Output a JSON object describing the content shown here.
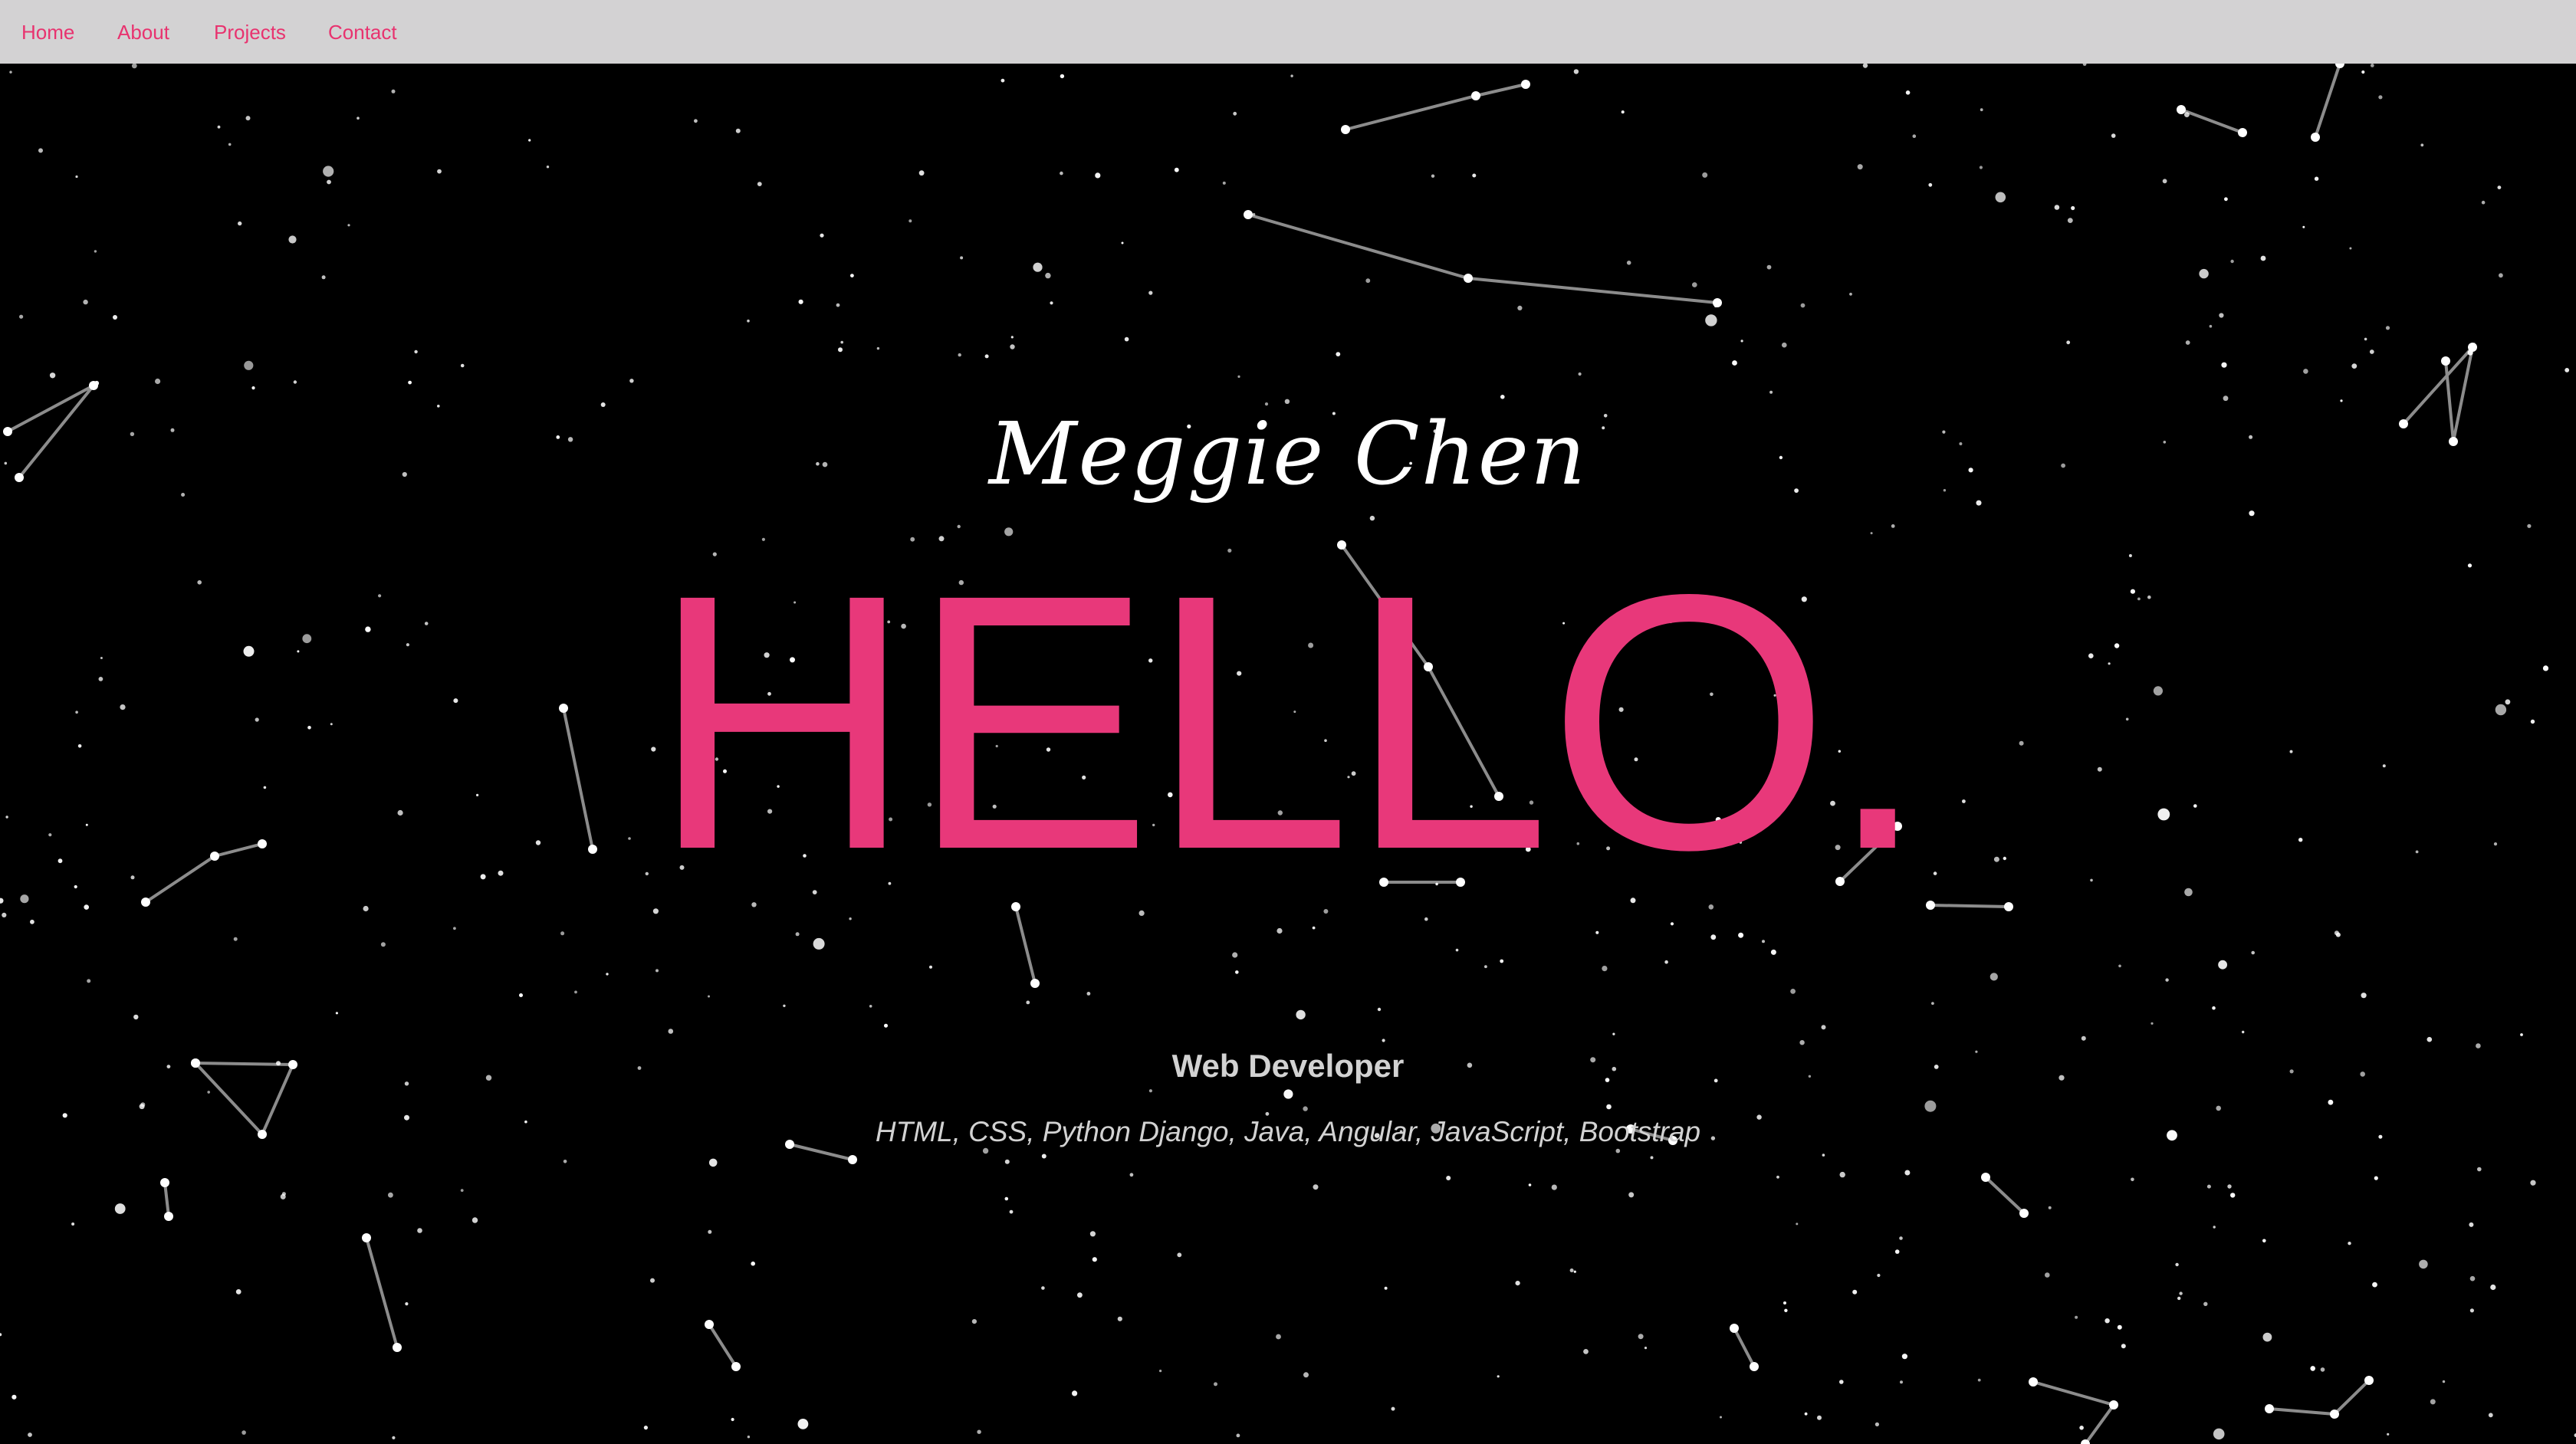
{
  "nav": {
    "items": [
      {
        "label": "Home"
      },
      {
        "label": "About"
      },
      {
        "label": "Projects"
      },
      {
        "label": "Contact"
      }
    ],
    "link_color": "#e8336f",
    "bar_color": "#d3d2d3"
  },
  "hero": {
    "name": "Meggie Chen",
    "greeting": "HELLO.",
    "role": "Web Developer",
    "skills": "HTML, CSS, Python Django, Java, Angular, JavaScript, Bootstrap",
    "greeting_color": "#e8387a",
    "background_color": "#000000",
    "star_color": "#ffffff"
  }
}
